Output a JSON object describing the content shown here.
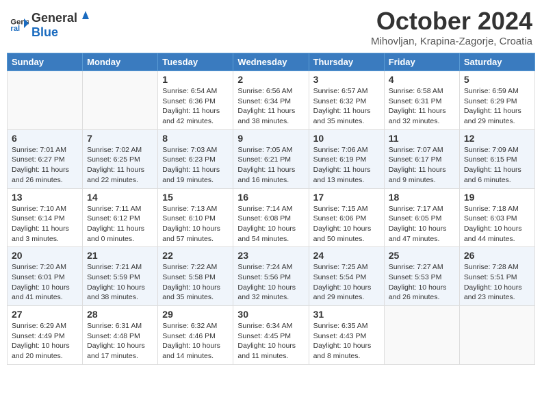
{
  "header": {
    "logo": {
      "general": "General",
      "blue": "Blue"
    },
    "title": "October 2024",
    "location": "Mihovljan, Krapina-Zagorje, Croatia"
  },
  "calendar": {
    "days_of_week": [
      "Sunday",
      "Monday",
      "Tuesday",
      "Wednesday",
      "Thursday",
      "Friday",
      "Saturday"
    ],
    "weeks": [
      [
        {
          "day": "",
          "info": ""
        },
        {
          "day": "",
          "info": ""
        },
        {
          "day": "1",
          "info": "Sunrise: 6:54 AM\nSunset: 6:36 PM\nDaylight: 11 hours and 42 minutes."
        },
        {
          "day": "2",
          "info": "Sunrise: 6:56 AM\nSunset: 6:34 PM\nDaylight: 11 hours and 38 minutes."
        },
        {
          "day": "3",
          "info": "Sunrise: 6:57 AM\nSunset: 6:32 PM\nDaylight: 11 hours and 35 minutes."
        },
        {
          "day": "4",
          "info": "Sunrise: 6:58 AM\nSunset: 6:31 PM\nDaylight: 11 hours and 32 minutes."
        },
        {
          "day": "5",
          "info": "Sunrise: 6:59 AM\nSunset: 6:29 PM\nDaylight: 11 hours and 29 minutes."
        }
      ],
      [
        {
          "day": "6",
          "info": "Sunrise: 7:01 AM\nSunset: 6:27 PM\nDaylight: 11 hours and 26 minutes."
        },
        {
          "day": "7",
          "info": "Sunrise: 7:02 AM\nSunset: 6:25 PM\nDaylight: 11 hours and 22 minutes."
        },
        {
          "day": "8",
          "info": "Sunrise: 7:03 AM\nSunset: 6:23 PM\nDaylight: 11 hours and 19 minutes."
        },
        {
          "day": "9",
          "info": "Sunrise: 7:05 AM\nSunset: 6:21 PM\nDaylight: 11 hours and 16 minutes."
        },
        {
          "day": "10",
          "info": "Sunrise: 7:06 AM\nSunset: 6:19 PM\nDaylight: 11 hours and 13 minutes."
        },
        {
          "day": "11",
          "info": "Sunrise: 7:07 AM\nSunset: 6:17 PM\nDaylight: 11 hours and 9 minutes."
        },
        {
          "day": "12",
          "info": "Sunrise: 7:09 AM\nSunset: 6:15 PM\nDaylight: 11 hours and 6 minutes."
        }
      ],
      [
        {
          "day": "13",
          "info": "Sunrise: 7:10 AM\nSunset: 6:14 PM\nDaylight: 11 hours and 3 minutes."
        },
        {
          "day": "14",
          "info": "Sunrise: 7:11 AM\nSunset: 6:12 PM\nDaylight: 11 hours and 0 minutes."
        },
        {
          "day": "15",
          "info": "Sunrise: 7:13 AM\nSunset: 6:10 PM\nDaylight: 10 hours and 57 minutes."
        },
        {
          "day": "16",
          "info": "Sunrise: 7:14 AM\nSunset: 6:08 PM\nDaylight: 10 hours and 54 minutes."
        },
        {
          "day": "17",
          "info": "Sunrise: 7:15 AM\nSunset: 6:06 PM\nDaylight: 10 hours and 50 minutes."
        },
        {
          "day": "18",
          "info": "Sunrise: 7:17 AM\nSunset: 6:05 PM\nDaylight: 10 hours and 47 minutes."
        },
        {
          "day": "19",
          "info": "Sunrise: 7:18 AM\nSunset: 6:03 PM\nDaylight: 10 hours and 44 minutes."
        }
      ],
      [
        {
          "day": "20",
          "info": "Sunrise: 7:20 AM\nSunset: 6:01 PM\nDaylight: 10 hours and 41 minutes."
        },
        {
          "day": "21",
          "info": "Sunrise: 7:21 AM\nSunset: 5:59 PM\nDaylight: 10 hours and 38 minutes."
        },
        {
          "day": "22",
          "info": "Sunrise: 7:22 AM\nSunset: 5:58 PM\nDaylight: 10 hours and 35 minutes."
        },
        {
          "day": "23",
          "info": "Sunrise: 7:24 AM\nSunset: 5:56 PM\nDaylight: 10 hours and 32 minutes."
        },
        {
          "day": "24",
          "info": "Sunrise: 7:25 AM\nSunset: 5:54 PM\nDaylight: 10 hours and 29 minutes."
        },
        {
          "day": "25",
          "info": "Sunrise: 7:27 AM\nSunset: 5:53 PM\nDaylight: 10 hours and 26 minutes."
        },
        {
          "day": "26",
          "info": "Sunrise: 7:28 AM\nSunset: 5:51 PM\nDaylight: 10 hours and 23 minutes."
        }
      ],
      [
        {
          "day": "27",
          "info": "Sunrise: 6:29 AM\nSunset: 4:49 PM\nDaylight: 10 hours and 20 minutes."
        },
        {
          "day": "28",
          "info": "Sunrise: 6:31 AM\nSunset: 4:48 PM\nDaylight: 10 hours and 17 minutes."
        },
        {
          "day": "29",
          "info": "Sunrise: 6:32 AM\nSunset: 4:46 PM\nDaylight: 10 hours and 14 minutes."
        },
        {
          "day": "30",
          "info": "Sunrise: 6:34 AM\nSunset: 4:45 PM\nDaylight: 10 hours and 11 minutes."
        },
        {
          "day": "31",
          "info": "Sunrise: 6:35 AM\nSunset: 4:43 PM\nDaylight: 10 hours and 8 minutes."
        },
        {
          "day": "",
          "info": ""
        },
        {
          "day": "",
          "info": ""
        }
      ]
    ]
  }
}
